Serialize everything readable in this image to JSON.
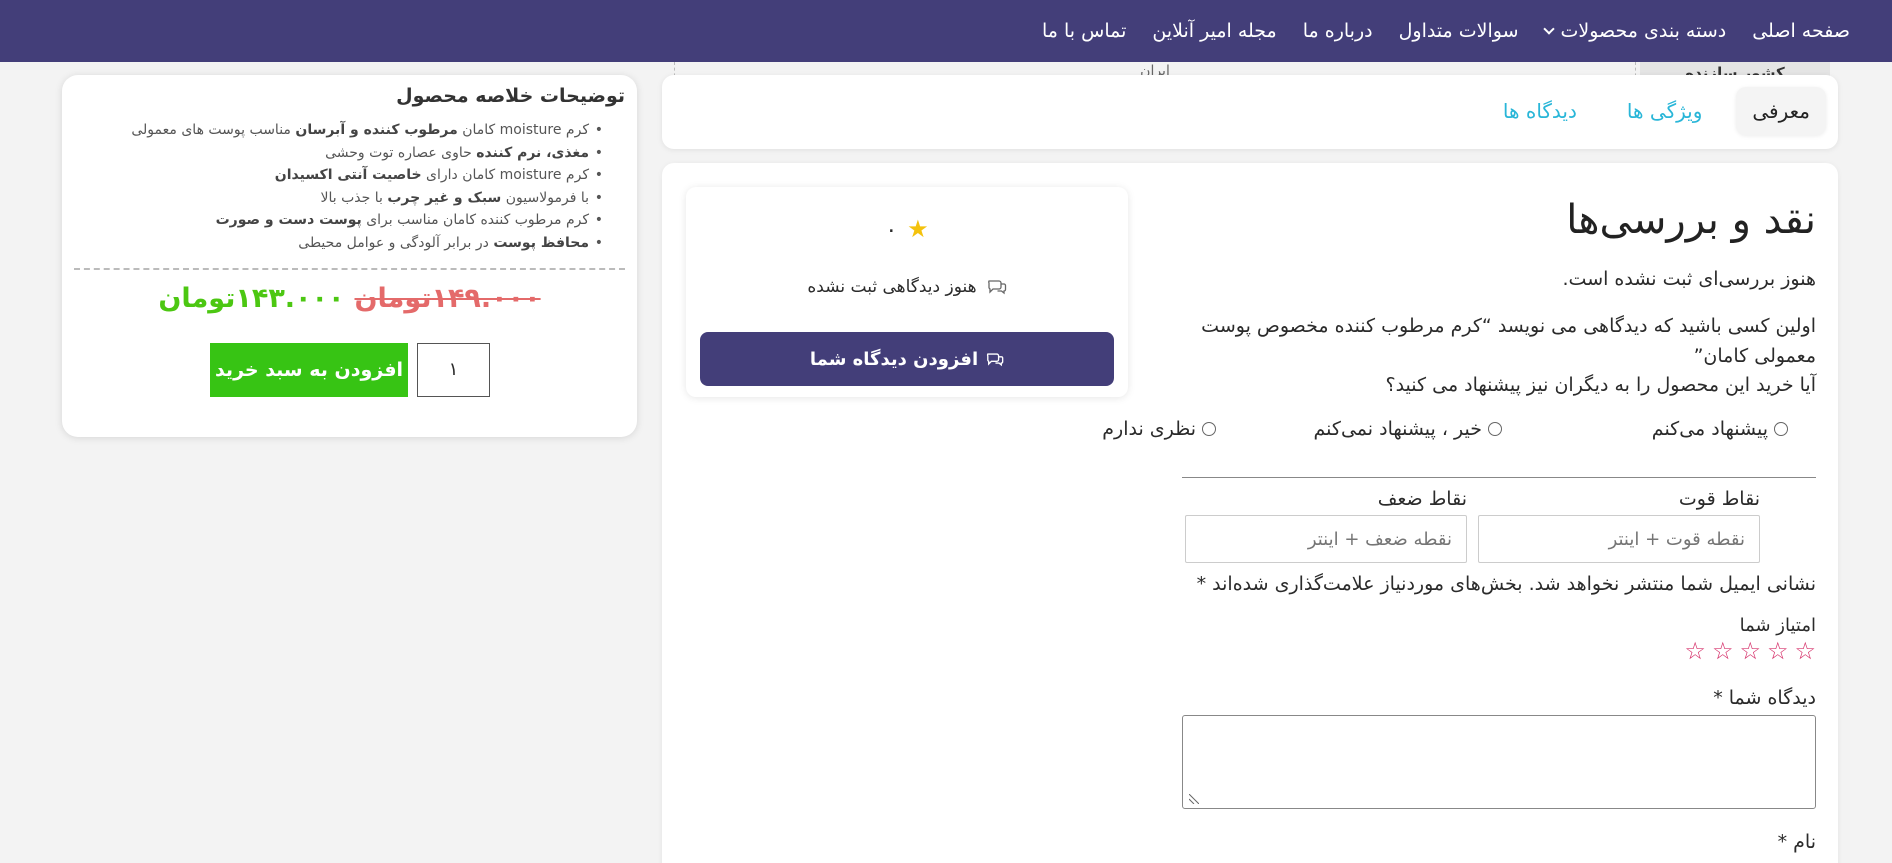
{
  "nav": {
    "items": [
      "صفحه اصلی",
      "دسته بندی محصولات",
      "سوالات متداول",
      "درباره ما",
      "مجله امیر آنلاین",
      "تماس با ما"
    ]
  },
  "spec_peek": {
    "value": "ایران",
    "label": "کشور سازنده"
  },
  "tabs": [
    "معرفی",
    "ویژگی ها",
    "دیدگاه ها"
  ],
  "review": {
    "title": "نقد و بررسی‌ها",
    "no_review": "هنوز بررسی‌ای ثبت نشده است.",
    "first_reviewer": "اولین کسی باشید که دیدگاهی می نویسد “کرم مرطوب کننده مخصوص پوست معمولی کامان”",
    "recommend_question": "آیا خرید این محصول را به دیگران نیز پیشنهاد می کنید؟",
    "recommend_options": [
      "پیشنهاد می‌کنم",
      "خیر ، پیشنهاد نمی‌کنم",
      "نظری ندارم"
    ],
    "pros_label": "نقاط قوت",
    "pros_placeholder": "نقطه قوت + اینتر",
    "cons_label": "نقاط ضعف",
    "cons_placeholder": "نقطه ضعف + اینتر",
    "email_note": "نشانی ایمیل شما منتشر نخواهد شد. بخش‌های موردنیاز علامت‌گذاری شده‌اند *",
    "rating_label": "امتیاز شما",
    "rating_count": 5,
    "comment_label": "دیدگاه شما *",
    "name_label": "نام *"
  },
  "summary": {
    "rating": "۰",
    "no_reviews": "هنوز دیدگاهی ثبت نشده",
    "add_review_button": "افزودن دیدگاه شما"
  },
  "product": {
    "title": "توضیحات خلاصه محصول",
    "features": [
      [
        {
          "t": "کرم moisture کامان "
        },
        {
          "t": "مرطوب کننده و آبرسان",
          "b": true
        },
        {
          "t": " مناسب پوست های معمولی"
        }
      ],
      [
        {
          "t": "مغذی، نرم کننده",
          "b": true
        },
        {
          "t": " حاوی عصاره توت وحشی"
        }
      ],
      [
        {
          "t": "کرم moisture کامان دارای "
        },
        {
          "t": "خاصیت آنتی اکسیدان",
          "b": true
        }
      ],
      [
        {
          "t": "با فرمولاسیون "
        },
        {
          "t": "سبک و غیر چرب",
          "b": true
        },
        {
          "t": " با جذب بالا"
        }
      ],
      [
        {
          "t": "کرم مرطوب کننده کامان مناسب برای "
        },
        {
          "t": "پوست دست و صورت",
          "b": true
        }
      ],
      [
        {
          "t": "محافظ پوست",
          "b": true
        },
        {
          "t": " در برابر آلودگی و عوامل محیطی"
        }
      ]
    ],
    "old_price": "۱۴۹.۰۰۰تومان",
    "new_price": "۱۴۳.۰۰۰تومان",
    "quantity": "۱",
    "add_to_cart": "افزودن به سبد خرید"
  },
  "colors": {
    "nav_bg": "#433e79",
    "accent": "#29b6d8",
    "cart_green": "#37c414",
    "old_price": "#e46a6a",
    "new_price": "#4cc712"
  }
}
